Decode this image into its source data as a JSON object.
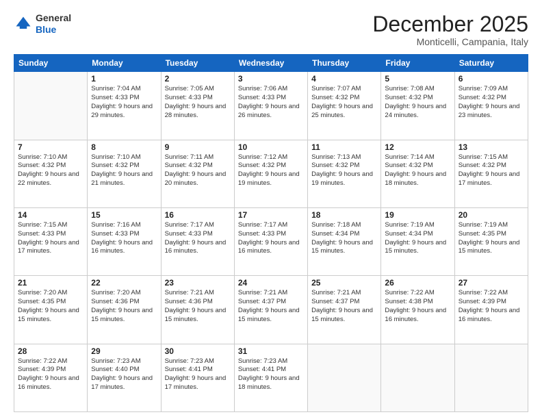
{
  "logo": {
    "general": "General",
    "blue": "Blue"
  },
  "header": {
    "month": "December 2025",
    "location": "Monticelli, Campania, Italy"
  },
  "days_of_week": [
    "Sunday",
    "Monday",
    "Tuesday",
    "Wednesday",
    "Thursday",
    "Friday",
    "Saturday"
  ],
  "weeks": [
    [
      {
        "day": "",
        "sunrise": "",
        "sunset": "",
        "daylight": ""
      },
      {
        "day": "1",
        "sunrise": "Sunrise: 7:04 AM",
        "sunset": "Sunset: 4:33 PM",
        "daylight": "Daylight: 9 hours and 29 minutes."
      },
      {
        "day": "2",
        "sunrise": "Sunrise: 7:05 AM",
        "sunset": "Sunset: 4:33 PM",
        "daylight": "Daylight: 9 hours and 28 minutes."
      },
      {
        "day": "3",
        "sunrise": "Sunrise: 7:06 AM",
        "sunset": "Sunset: 4:33 PM",
        "daylight": "Daylight: 9 hours and 26 minutes."
      },
      {
        "day": "4",
        "sunrise": "Sunrise: 7:07 AM",
        "sunset": "Sunset: 4:32 PM",
        "daylight": "Daylight: 9 hours and 25 minutes."
      },
      {
        "day": "5",
        "sunrise": "Sunrise: 7:08 AM",
        "sunset": "Sunset: 4:32 PM",
        "daylight": "Daylight: 9 hours and 24 minutes."
      },
      {
        "day": "6",
        "sunrise": "Sunrise: 7:09 AM",
        "sunset": "Sunset: 4:32 PM",
        "daylight": "Daylight: 9 hours and 23 minutes."
      }
    ],
    [
      {
        "day": "7",
        "sunrise": "Sunrise: 7:10 AM",
        "sunset": "Sunset: 4:32 PM",
        "daylight": "Daylight: 9 hours and 22 minutes."
      },
      {
        "day": "8",
        "sunrise": "Sunrise: 7:10 AM",
        "sunset": "Sunset: 4:32 PM",
        "daylight": "Daylight: 9 hours and 21 minutes."
      },
      {
        "day": "9",
        "sunrise": "Sunrise: 7:11 AM",
        "sunset": "Sunset: 4:32 PM",
        "daylight": "Daylight: 9 hours and 20 minutes."
      },
      {
        "day": "10",
        "sunrise": "Sunrise: 7:12 AM",
        "sunset": "Sunset: 4:32 PM",
        "daylight": "Daylight: 9 hours and 19 minutes."
      },
      {
        "day": "11",
        "sunrise": "Sunrise: 7:13 AM",
        "sunset": "Sunset: 4:32 PM",
        "daylight": "Daylight: 9 hours and 19 minutes."
      },
      {
        "day": "12",
        "sunrise": "Sunrise: 7:14 AM",
        "sunset": "Sunset: 4:32 PM",
        "daylight": "Daylight: 9 hours and 18 minutes."
      },
      {
        "day": "13",
        "sunrise": "Sunrise: 7:15 AM",
        "sunset": "Sunset: 4:32 PM",
        "daylight": "Daylight: 9 hours and 17 minutes."
      }
    ],
    [
      {
        "day": "14",
        "sunrise": "Sunrise: 7:15 AM",
        "sunset": "Sunset: 4:33 PM",
        "daylight": "Daylight: 9 hours and 17 minutes."
      },
      {
        "day": "15",
        "sunrise": "Sunrise: 7:16 AM",
        "sunset": "Sunset: 4:33 PM",
        "daylight": "Daylight: 9 hours and 16 minutes."
      },
      {
        "day": "16",
        "sunrise": "Sunrise: 7:17 AM",
        "sunset": "Sunset: 4:33 PM",
        "daylight": "Daylight: 9 hours and 16 minutes."
      },
      {
        "day": "17",
        "sunrise": "Sunrise: 7:17 AM",
        "sunset": "Sunset: 4:33 PM",
        "daylight": "Daylight: 9 hours and 16 minutes."
      },
      {
        "day": "18",
        "sunrise": "Sunrise: 7:18 AM",
        "sunset": "Sunset: 4:34 PM",
        "daylight": "Daylight: 9 hours and 15 minutes."
      },
      {
        "day": "19",
        "sunrise": "Sunrise: 7:19 AM",
        "sunset": "Sunset: 4:34 PM",
        "daylight": "Daylight: 9 hours and 15 minutes."
      },
      {
        "day": "20",
        "sunrise": "Sunrise: 7:19 AM",
        "sunset": "Sunset: 4:35 PM",
        "daylight": "Daylight: 9 hours and 15 minutes."
      }
    ],
    [
      {
        "day": "21",
        "sunrise": "Sunrise: 7:20 AM",
        "sunset": "Sunset: 4:35 PM",
        "daylight": "Daylight: 9 hours and 15 minutes."
      },
      {
        "day": "22",
        "sunrise": "Sunrise: 7:20 AM",
        "sunset": "Sunset: 4:36 PM",
        "daylight": "Daylight: 9 hours and 15 minutes."
      },
      {
        "day": "23",
        "sunrise": "Sunrise: 7:21 AM",
        "sunset": "Sunset: 4:36 PM",
        "daylight": "Daylight: 9 hours and 15 minutes."
      },
      {
        "day": "24",
        "sunrise": "Sunrise: 7:21 AM",
        "sunset": "Sunset: 4:37 PM",
        "daylight": "Daylight: 9 hours and 15 minutes."
      },
      {
        "day": "25",
        "sunrise": "Sunrise: 7:21 AM",
        "sunset": "Sunset: 4:37 PM",
        "daylight": "Daylight: 9 hours and 15 minutes."
      },
      {
        "day": "26",
        "sunrise": "Sunrise: 7:22 AM",
        "sunset": "Sunset: 4:38 PM",
        "daylight": "Daylight: 9 hours and 16 minutes."
      },
      {
        "day": "27",
        "sunrise": "Sunrise: 7:22 AM",
        "sunset": "Sunset: 4:39 PM",
        "daylight": "Daylight: 9 hours and 16 minutes."
      }
    ],
    [
      {
        "day": "28",
        "sunrise": "Sunrise: 7:22 AM",
        "sunset": "Sunset: 4:39 PM",
        "daylight": "Daylight: 9 hours and 16 minutes."
      },
      {
        "day": "29",
        "sunrise": "Sunrise: 7:23 AM",
        "sunset": "Sunset: 4:40 PM",
        "daylight": "Daylight: 9 hours and 17 minutes."
      },
      {
        "day": "30",
        "sunrise": "Sunrise: 7:23 AM",
        "sunset": "Sunset: 4:41 PM",
        "daylight": "Daylight: 9 hours and 17 minutes."
      },
      {
        "day": "31",
        "sunrise": "Sunrise: 7:23 AM",
        "sunset": "Sunset: 4:41 PM",
        "daylight": "Daylight: 9 hours and 18 minutes."
      },
      {
        "day": "",
        "sunrise": "",
        "sunset": "",
        "daylight": ""
      },
      {
        "day": "",
        "sunrise": "",
        "sunset": "",
        "daylight": ""
      },
      {
        "day": "",
        "sunrise": "",
        "sunset": "",
        "daylight": ""
      }
    ]
  ]
}
